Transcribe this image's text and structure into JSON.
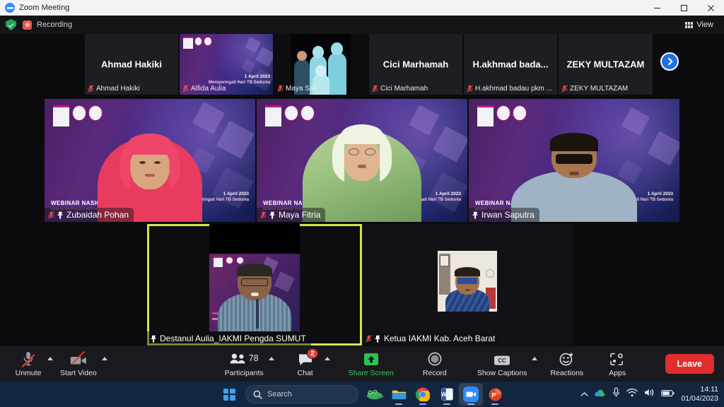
{
  "window": {
    "title": "Zoom Meeting",
    "app_icon": "zoom-icon",
    "minimize": "minimize-icon",
    "maximize": "maximize-icon",
    "close": "close-icon"
  },
  "topbar": {
    "encryption_icon": "shield-icon",
    "recording_icon": "recording-icon",
    "recording_label": "Recording",
    "view_label": "View",
    "view_icon": "grid-icon"
  },
  "filmstrip": {
    "next_label": "next-page-arrow",
    "tiles": [
      {
        "display_name": "Ahmad Hakiki",
        "label": "Ahmad Hakiki",
        "muted": true,
        "video_off": true
      },
      {
        "display_name": "",
        "label": "Alfida Aulia",
        "muted": true,
        "video_off": false
      },
      {
        "display_name": "",
        "label": "Maya Sari",
        "muted": true,
        "video_off": false
      },
      {
        "display_name": "Cici Marhamah",
        "label": "Cici Marhamah",
        "muted": true,
        "video_off": true
      },
      {
        "display_name": "H.akhmad  bada...",
        "label": "H.akhmad badau pkm ...",
        "muted": true,
        "video_off": true
      },
      {
        "display_name": "ZEKY MULTAZAM",
        "label": "ZEKY MULTAZAM",
        "muted": true,
        "video_off": true
      }
    ]
  },
  "backdrop": {
    "title": "WEBINAR NASIONAL",
    "subtitle": "DEWAN PIMPINAN DAERAH IAKMI SUMATERA UTARA",
    "date": "1 April 2023",
    "date_sub": "Memperingati Hari TB Sedunia"
  },
  "stage": {
    "tiles": [
      {
        "name": "Zubaidah Pohan",
        "pinned": true,
        "muted": true,
        "speaking": false
      },
      {
        "name": "Maya Fitria",
        "pinned": true,
        "muted": true,
        "speaking": false
      },
      {
        "name": "Irwan Saputra",
        "pinned": true,
        "muted": false,
        "speaking": false
      },
      {
        "name": "Destanul Aulia_IAKMI Pengda SUMUT",
        "pinned": true,
        "muted": false,
        "speaking": true
      },
      {
        "name": "Ketua IAKMI Kab. Aceh Barat",
        "pinned": true,
        "muted": true,
        "speaking": false
      }
    ],
    "speaking_border_color": "#d7e44a"
  },
  "controls": {
    "audio": {
      "label": "Unmute",
      "icon": "microphone-muted-icon",
      "has_caret": true
    },
    "video": {
      "label": "Start Video",
      "icon": "camera-off-icon",
      "has_caret": true
    },
    "participants": {
      "label": "Participants",
      "icon": "people-icon",
      "count": "78",
      "has_caret": true
    },
    "chat": {
      "label": "Chat",
      "icon": "chat-bubble-icon",
      "badge": "2",
      "has_caret": true
    },
    "share": {
      "label": "Share Screen",
      "icon": "share-screen-icon",
      "accent": "#3ec65a"
    },
    "record": {
      "label": "Record",
      "icon": "record-circle-icon"
    },
    "captions": {
      "label": "Show Captions",
      "icon": "cc-icon",
      "has_caret": true
    },
    "reactions": {
      "label": "Reactions",
      "icon": "smiley-plus-icon"
    },
    "apps": {
      "label": "Apps",
      "icon": "apps-icon"
    },
    "leave": {
      "label": "Leave",
      "color": "#e02d2d"
    }
  },
  "taskbar": {
    "start_icon": "windows-start-icon",
    "search_placeholder": "Search",
    "search_icon": "search-icon",
    "apps": [
      {
        "name": "widget-frog-icon",
        "running": false
      },
      {
        "name": "file-explorer-icon",
        "running": true
      },
      {
        "name": "google-chrome-icon",
        "running": true
      },
      {
        "name": "microsoft-word-icon",
        "running": true
      },
      {
        "name": "zoom-app-icon",
        "running": true,
        "active": true
      },
      {
        "name": "powerpoint-icon",
        "running": true
      }
    ],
    "tray": {
      "overflow_icon": "chevron-up-icon",
      "onedrive_icon": "cloud-icon",
      "mic_icon": "microphone-icon",
      "wifi_icon": "wifi-icon",
      "volume_icon": "speaker-icon",
      "battery_icon": "battery-icon"
    },
    "time": "14:11",
    "date": "01/04/2023"
  }
}
